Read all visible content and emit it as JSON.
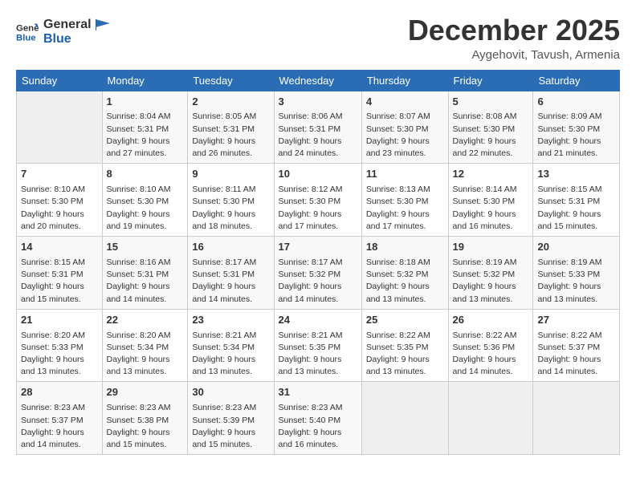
{
  "header": {
    "logo_line1": "General",
    "logo_line2": "Blue",
    "month": "December 2025",
    "location": "Aygehovit, Tavush, Armenia"
  },
  "days_of_week": [
    "Sunday",
    "Monday",
    "Tuesday",
    "Wednesday",
    "Thursday",
    "Friday",
    "Saturday"
  ],
  "weeks": [
    [
      {
        "num": "",
        "sunrise": "",
        "sunset": "",
        "daylight": ""
      },
      {
        "num": "1",
        "sunrise": "Sunrise: 8:04 AM",
        "sunset": "Sunset: 5:31 PM",
        "daylight": "Daylight: 9 hours and 27 minutes."
      },
      {
        "num": "2",
        "sunrise": "Sunrise: 8:05 AM",
        "sunset": "Sunset: 5:31 PM",
        "daylight": "Daylight: 9 hours and 26 minutes."
      },
      {
        "num": "3",
        "sunrise": "Sunrise: 8:06 AM",
        "sunset": "Sunset: 5:31 PM",
        "daylight": "Daylight: 9 hours and 24 minutes."
      },
      {
        "num": "4",
        "sunrise": "Sunrise: 8:07 AM",
        "sunset": "Sunset: 5:30 PM",
        "daylight": "Daylight: 9 hours and 23 minutes."
      },
      {
        "num": "5",
        "sunrise": "Sunrise: 8:08 AM",
        "sunset": "Sunset: 5:30 PM",
        "daylight": "Daylight: 9 hours and 22 minutes."
      },
      {
        "num": "6",
        "sunrise": "Sunrise: 8:09 AM",
        "sunset": "Sunset: 5:30 PM",
        "daylight": "Daylight: 9 hours and 21 minutes."
      }
    ],
    [
      {
        "num": "7",
        "sunrise": "Sunrise: 8:10 AM",
        "sunset": "Sunset: 5:30 PM",
        "daylight": "Daylight: 9 hours and 20 minutes."
      },
      {
        "num": "8",
        "sunrise": "Sunrise: 8:10 AM",
        "sunset": "Sunset: 5:30 PM",
        "daylight": "Daylight: 9 hours and 19 minutes."
      },
      {
        "num": "9",
        "sunrise": "Sunrise: 8:11 AM",
        "sunset": "Sunset: 5:30 PM",
        "daylight": "Daylight: 9 hours and 18 minutes."
      },
      {
        "num": "10",
        "sunrise": "Sunrise: 8:12 AM",
        "sunset": "Sunset: 5:30 PM",
        "daylight": "Daylight: 9 hours and 17 minutes."
      },
      {
        "num": "11",
        "sunrise": "Sunrise: 8:13 AM",
        "sunset": "Sunset: 5:30 PM",
        "daylight": "Daylight: 9 hours and 17 minutes."
      },
      {
        "num": "12",
        "sunrise": "Sunrise: 8:14 AM",
        "sunset": "Sunset: 5:30 PM",
        "daylight": "Daylight: 9 hours and 16 minutes."
      },
      {
        "num": "13",
        "sunrise": "Sunrise: 8:15 AM",
        "sunset": "Sunset: 5:31 PM",
        "daylight": "Daylight: 9 hours and 15 minutes."
      }
    ],
    [
      {
        "num": "14",
        "sunrise": "Sunrise: 8:15 AM",
        "sunset": "Sunset: 5:31 PM",
        "daylight": "Daylight: 9 hours and 15 minutes."
      },
      {
        "num": "15",
        "sunrise": "Sunrise: 8:16 AM",
        "sunset": "Sunset: 5:31 PM",
        "daylight": "Daylight: 9 hours and 14 minutes."
      },
      {
        "num": "16",
        "sunrise": "Sunrise: 8:17 AM",
        "sunset": "Sunset: 5:31 PM",
        "daylight": "Daylight: 9 hours and 14 minutes."
      },
      {
        "num": "17",
        "sunrise": "Sunrise: 8:17 AM",
        "sunset": "Sunset: 5:32 PM",
        "daylight": "Daylight: 9 hours and 14 minutes."
      },
      {
        "num": "18",
        "sunrise": "Sunrise: 8:18 AM",
        "sunset": "Sunset: 5:32 PM",
        "daylight": "Daylight: 9 hours and 13 minutes."
      },
      {
        "num": "19",
        "sunrise": "Sunrise: 8:19 AM",
        "sunset": "Sunset: 5:32 PM",
        "daylight": "Daylight: 9 hours and 13 minutes."
      },
      {
        "num": "20",
        "sunrise": "Sunrise: 8:19 AM",
        "sunset": "Sunset: 5:33 PM",
        "daylight": "Daylight: 9 hours and 13 minutes."
      }
    ],
    [
      {
        "num": "21",
        "sunrise": "Sunrise: 8:20 AM",
        "sunset": "Sunset: 5:33 PM",
        "daylight": "Daylight: 9 hours and 13 minutes."
      },
      {
        "num": "22",
        "sunrise": "Sunrise: 8:20 AM",
        "sunset": "Sunset: 5:34 PM",
        "daylight": "Daylight: 9 hours and 13 minutes."
      },
      {
        "num": "23",
        "sunrise": "Sunrise: 8:21 AM",
        "sunset": "Sunset: 5:34 PM",
        "daylight": "Daylight: 9 hours and 13 minutes."
      },
      {
        "num": "24",
        "sunrise": "Sunrise: 8:21 AM",
        "sunset": "Sunset: 5:35 PM",
        "daylight": "Daylight: 9 hours and 13 minutes."
      },
      {
        "num": "25",
        "sunrise": "Sunrise: 8:22 AM",
        "sunset": "Sunset: 5:35 PM",
        "daylight": "Daylight: 9 hours and 13 minutes."
      },
      {
        "num": "26",
        "sunrise": "Sunrise: 8:22 AM",
        "sunset": "Sunset: 5:36 PM",
        "daylight": "Daylight: 9 hours and 14 minutes."
      },
      {
        "num": "27",
        "sunrise": "Sunrise: 8:22 AM",
        "sunset": "Sunset: 5:37 PM",
        "daylight": "Daylight: 9 hours and 14 minutes."
      }
    ],
    [
      {
        "num": "28",
        "sunrise": "Sunrise: 8:23 AM",
        "sunset": "Sunset: 5:37 PM",
        "daylight": "Daylight: 9 hours and 14 minutes."
      },
      {
        "num": "29",
        "sunrise": "Sunrise: 8:23 AM",
        "sunset": "Sunset: 5:38 PM",
        "daylight": "Daylight: 9 hours and 15 minutes."
      },
      {
        "num": "30",
        "sunrise": "Sunrise: 8:23 AM",
        "sunset": "Sunset: 5:39 PM",
        "daylight": "Daylight: 9 hours and 15 minutes."
      },
      {
        "num": "31",
        "sunrise": "Sunrise: 8:23 AM",
        "sunset": "Sunset: 5:40 PM",
        "daylight": "Daylight: 9 hours and 16 minutes."
      },
      {
        "num": "",
        "sunrise": "",
        "sunset": "",
        "daylight": ""
      },
      {
        "num": "",
        "sunrise": "",
        "sunset": "",
        "daylight": ""
      },
      {
        "num": "",
        "sunrise": "",
        "sunset": "",
        "daylight": ""
      }
    ]
  ]
}
